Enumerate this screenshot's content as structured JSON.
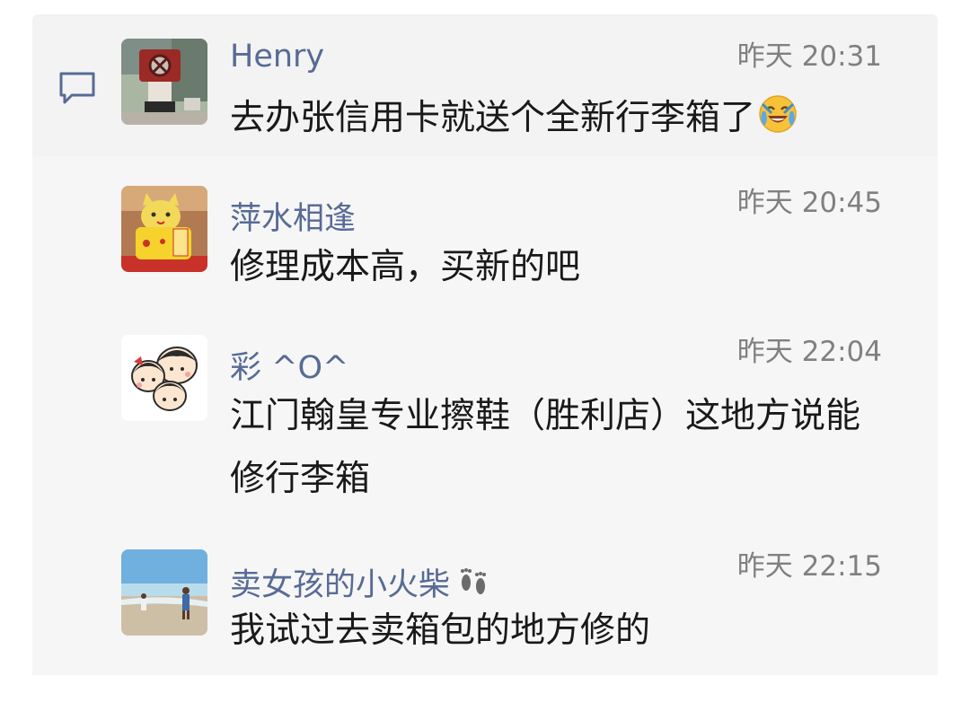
{
  "comments": [
    {
      "name": "Henry",
      "time": "昨天 20:31",
      "text": "去办张信用卡就送个全新行李箱了",
      "emoji": "laughing-crying-face"
    },
    {
      "name": "萍水相逢",
      "time": "昨天 20:45",
      "text": "修理成本高，买新的吧"
    },
    {
      "name": "彩 ^O^",
      "time": "昨天 22:04",
      "text": "江门翰皇专业擦鞋（胜利店）这地方说能修行李箱"
    },
    {
      "name": "卖女孩的小火柴",
      "time": "昨天 22:15",
      "text": "我试过去卖箱包的地方修的",
      "name_emoji": "footprints"
    }
  ],
  "colors": {
    "name": "#576b95",
    "time": "#808080",
    "text": "#191919",
    "panel": "#f6f6f6"
  }
}
